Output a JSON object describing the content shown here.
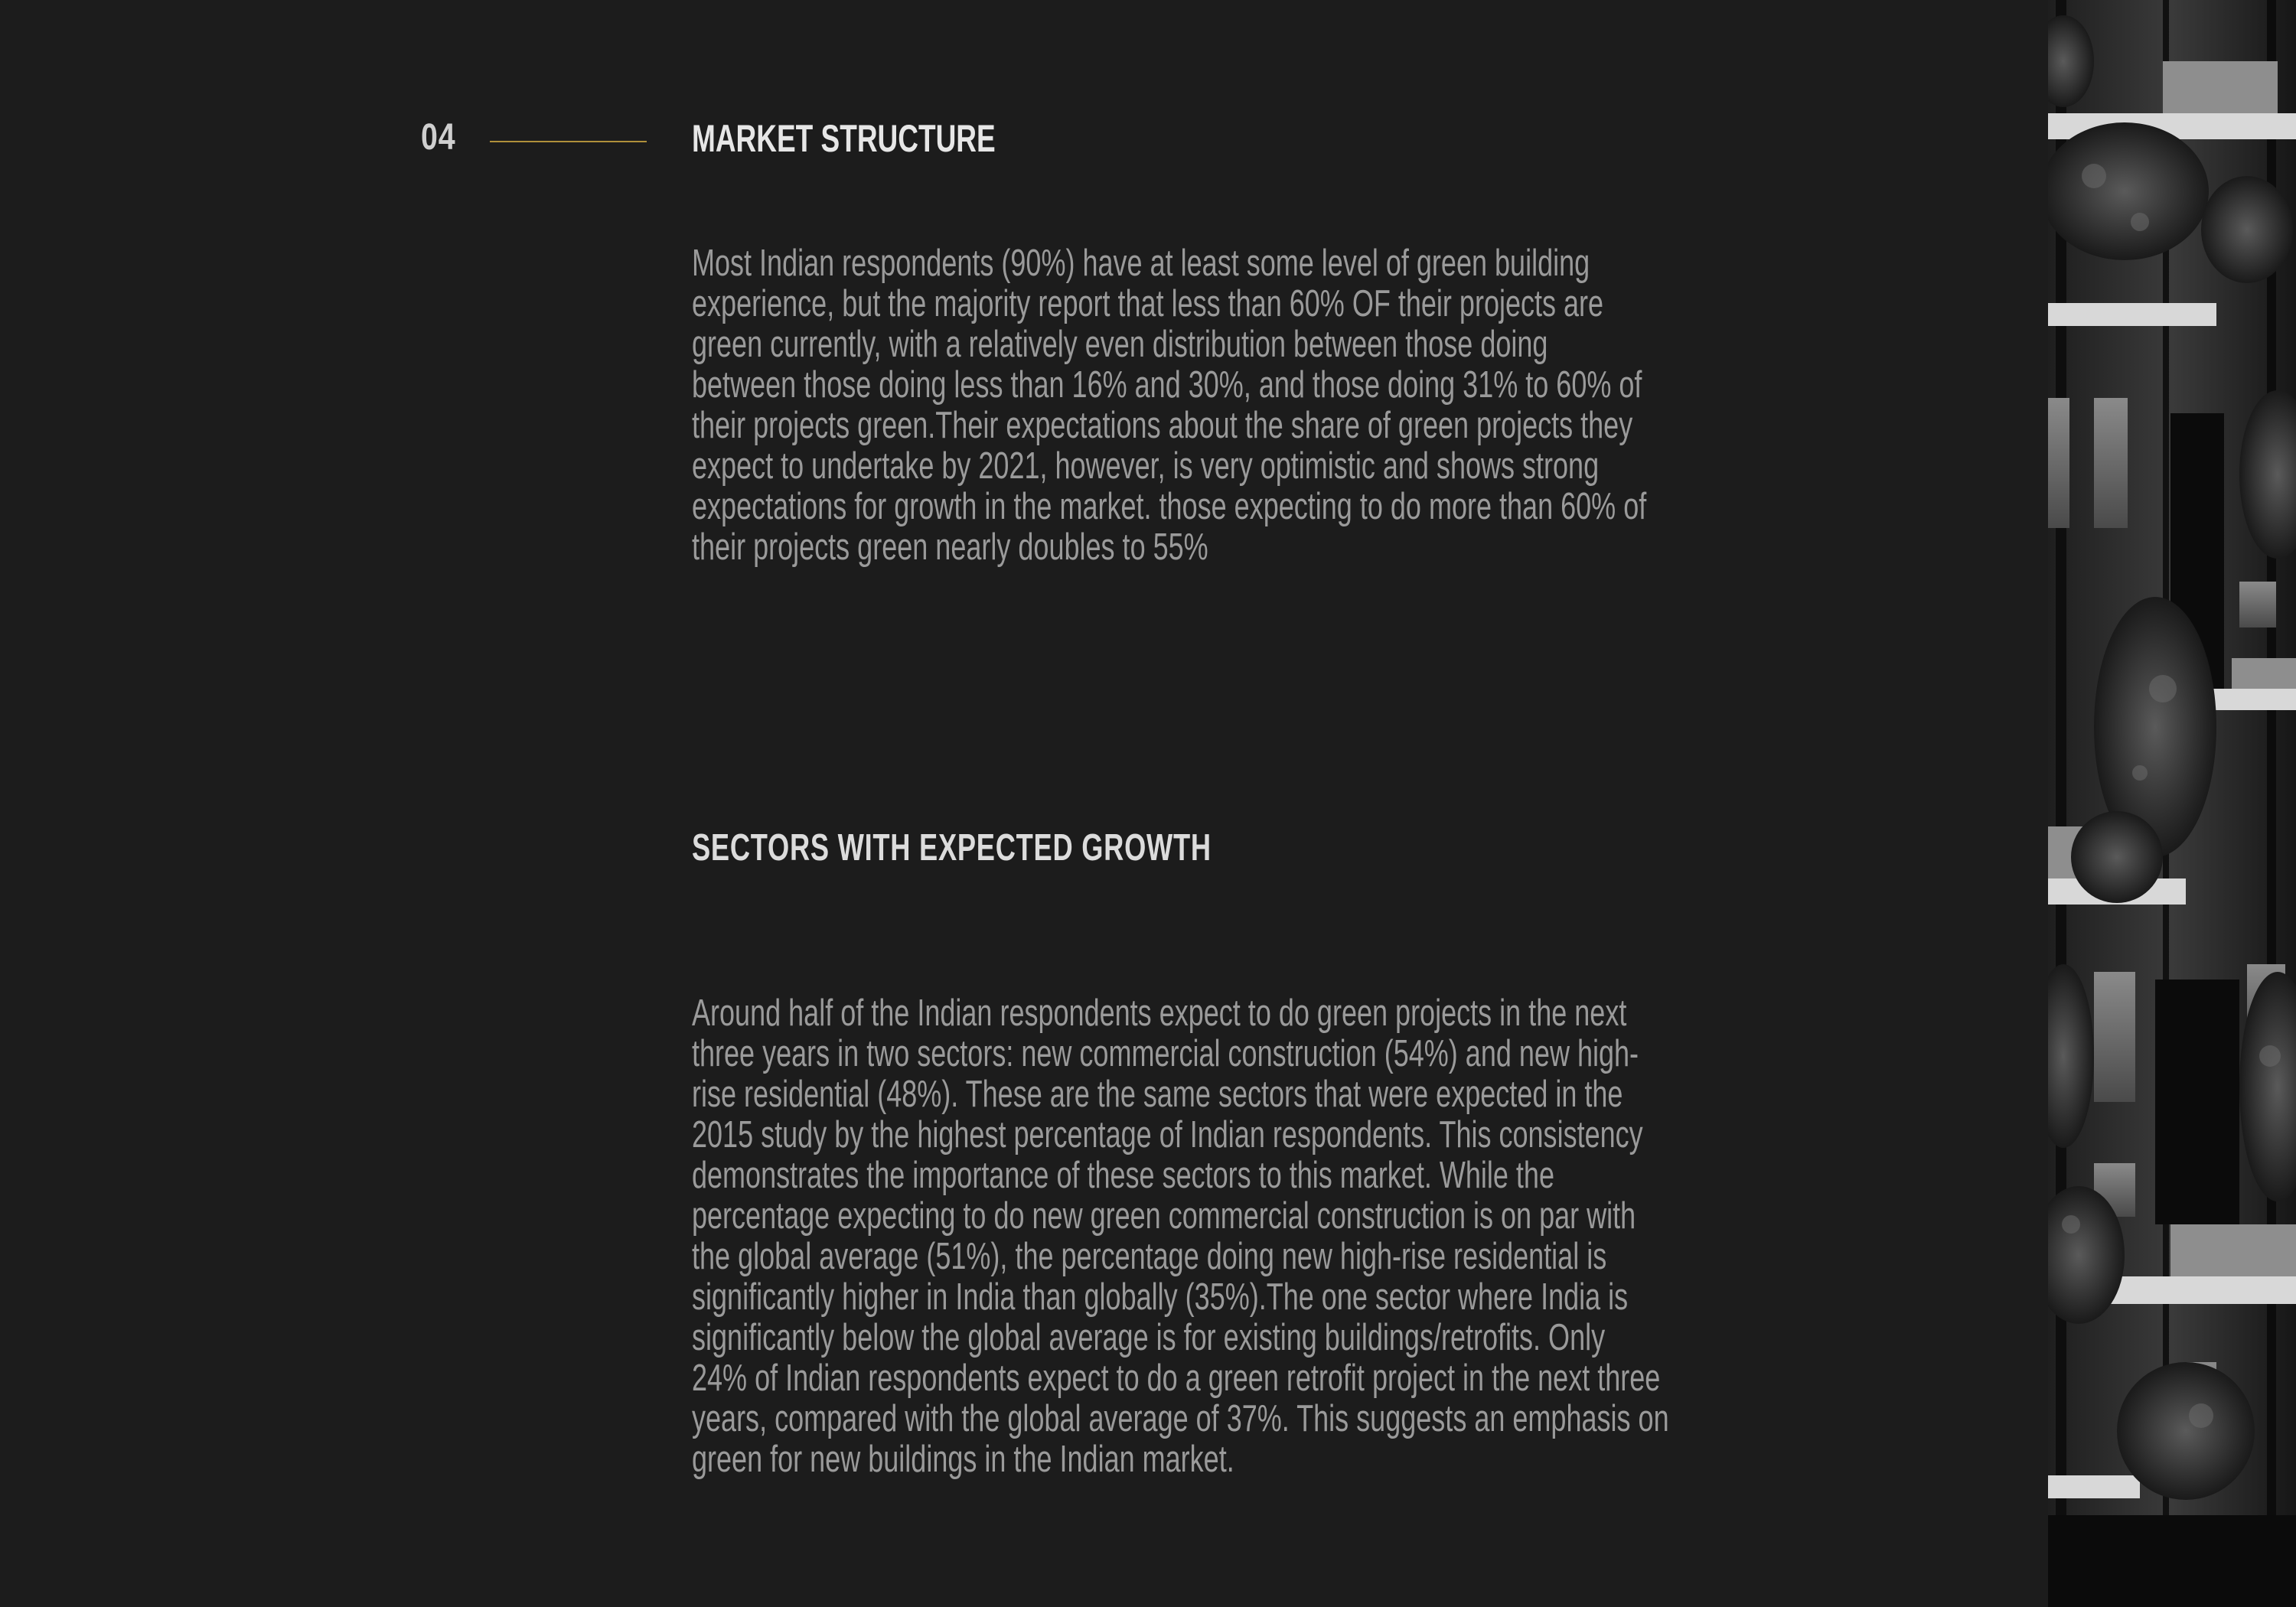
{
  "section": {
    "number": "04",
    "title": "MARKET STRUCTURE"
  },
  "intro_paragraph": [
    "Most Indian respondents (90%) have at least some level of green building",
    "experience, but the majority report that less than 60% OF their projects are",
    "green currently, with a relatively even distribution between those doing",
    "between those doing less than 16% and 30%, and those doing 31% to 60% of",
    "their projects green.Their expectations about the share of green projects they",
    "expect to undertake by 2021, however, is very optimistic and shows strong",
    "expectations for growth in the market. those expecting to do more than 60% of",
    "their projects green nearly doubles to 55%"
  ],
  "subsection": {
    "title": "SECTORS WITH EXPECTED GROWTH"
  },
  "growth_paragraph": [
    "Around half of the Indian respondents expect to do green projects in the next",
    "three years in two sectors: new commercial construction (54%) and new high-",
    "rise residential (48%). These are the same sectors that were expected in the",
    "2015 study by the highest percentage of Indian respondents. This consistency",
    "demonstrates the importance of these sectors to this market. While the",
    "percentage expecting to do new green commercial construction is on par with",
    "the global average (51%), the percentage doing new high-rise residential is",
    "significantly higher in India than globally (35%).The one sector where India is",
    "significantly below the global average is for existing buildings/retrofits. Only",
    "24% of Indian respondents expect to do a green retrofit project in the next three",
    "years, compared with the global average of 37%. This suggests an emphasis on",
    "green for new buildings in the Indian market."
  ],
  "colors": {
    "background": "#1c1c1c",
    "accent_rule": "#b0903a",
    "heading": "#e6e6e6",
    "body_text": "#9a9a9a"
  },
  "photo": {
    "subject": "building-facade-with-balconies-and-plants-photo"
  }
}
